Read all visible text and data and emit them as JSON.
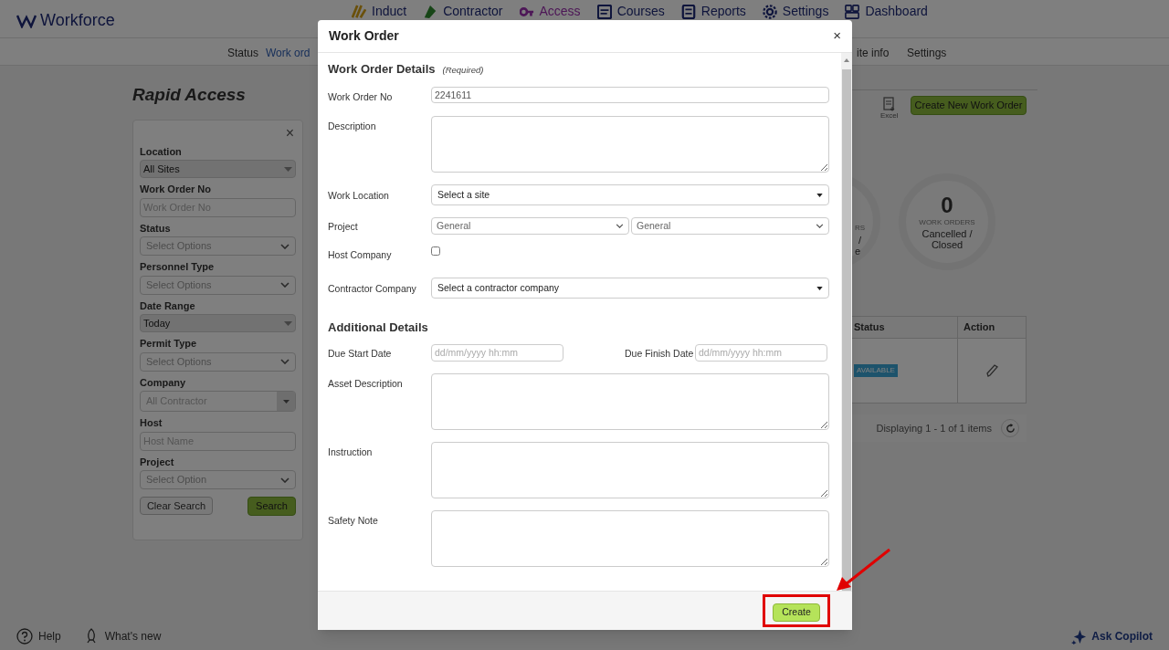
{
  "header": {
    "logo": "Workforce",
    "nav": [
      {
        "label": "Induct",
        "selected": false
      },
      {
        "label": "Contractor",
        "selected": false
      },
      {
        "label": "Access",
        "selected": true
      },
      {
        "label": "Courses",
        "selected": false
      },
      {
        "label": "Reports",
        "selected": false
      },
      {
        "label": "Settings",
        "selected": false
      },
      {
        "label": "Dashboard",
        "selected": false
      }
    ]
  },
  "subnav": [
    {
      "label": "Status",
      "selected": false
    },
    {
      "label": "Work ord",
      "selected": true
    },
    {
      "label": "ite info",
      "selected": false
    },
    {
      "label": "Settings",
      "selected": false
    }
  ],
  "page_title": "Rapid Access",
  "filters": {
    "close": "×",
    "fields": [
      {
        "kind": "dropdown",
        "label": "Location",
        "value": "All Sites"
      },
      {
        "kind": "text",
        "label": "Work Order No",
        "placeholder": "Work Order No"
      },
      {
        "kind": "multiselect",
        "label": "Status",
        "placeholder": "Select Options"
      },
      {
        "kind": "multiselect",
        "label": "Personnel Type",
        "placeholder": "Select Options"
      },
      {
        "kind": "dropdown",
        "label": "Date Range",
        "value": "Today"
      },
      {
        "kind": "multiselect",
        "label": "Permit Type",
        "placeholder": "Select Options"
      },
      {
        "kind": "combo",
        "label": "Company",
        "placeholder": "All Contractor"
      },
      {
        "kind": "text",
        "label": "Host",
        "placeholder": "Host Name"
      },
      {
        "kind": "multiselect",
        "label": "Project",
        "placeholder": "Select Option"
      }
    ],
    "clear_button": "Clear Search",
    "search_button": "Search"
  },
  "toolbar": {
    "excel": "Excel",
    "create_button": "Create New Work Order"
  },
  "summary": [
    {
      "texts": [
        "RS",
        "/",
        "e"
      ]
    },
    {
      "count": "0",
      "caption": "WORK ORDERS",
      "label": "Cancelled / Closed"
    }
  ],
  "table": {
    "columns": [
      "Status",
      "Action"
    ],
    "rows": [
      {
        "status": "AVAILABLE"
      }
    ],
    "footer": "Displaying 1 - 1 of 1 items"
  },
  "bottom_bar": {
    "help": "Help",
    "whats_new": "What's new",
    "copilot": "Ask Copilot"
  },
  "modal": {
    "title": "Work Order",
    "close": "×",
    "sections": [
      {
        "heading": "Work Order Details",
        "note": "(Required)",
        "fields": [
          {
            "kind": "text",
            "label": "Work Order No",
            "value": "2241611"
          },
          {
            "kind": "textarea",
            "label": "Description"
          },
          {
            "kind": "select",
            "label": "Work Location",
            "value": "Select a site"
          },
          {
            "kind": "select_pair",
            "label": "Project",
            "values": [
              "General",
              "General"
            ]
          },
          {
            "kind": "checkbox",
            "label": "Host Company",
            "checked": false
          },
          {
            "kind": "select",
            "label": "Contractor Company",
            "value": "Select a contractor company"
          }
        ]
      },
      {
        "heading": "Additional Details",
        "fields": [
          {
            "kind": "date_pair",
            "label": "Due Start Date",
            "placeholder": "dd/mm/yyyy hh:mm",
            "label_2": "Due Finish Date",
            "placeholder_2": "dd/mm/yyyy hh:mm"
          },
          {
            "kind": "textarea",
            "label": "Asset Description"
          },
          {
            "kind": "textarea",
            "label": "Instruction"
          },
          {
            "kind": "textarea",
            "label": "Safety Note"
          }
        ]
      }
    ],
    "create_button": "Create"
  }
}
